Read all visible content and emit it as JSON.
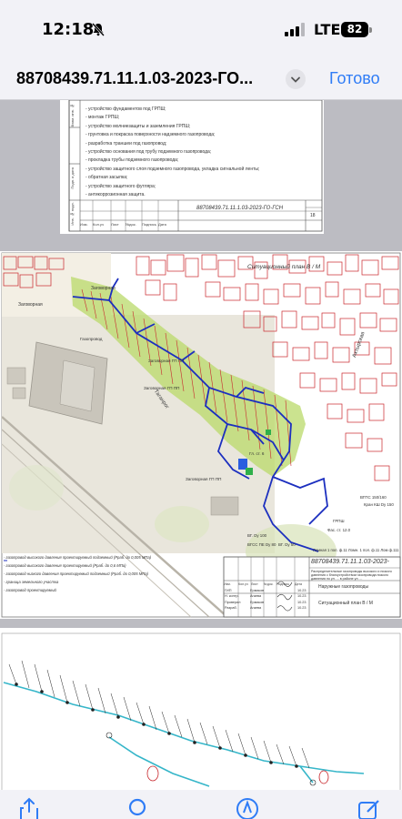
{
  "status_bar": {
    "time": "12:18",
    "network": "LTE",
    "battery": "82"
  },
  "nav": {
    "title": "88708439.71.11.1.03-2023-ГО...",
    "done_label": "Готово"
  },
  "page1": {
    "list_items": [
      "- устройство фундаментов под ГРПШ;",
      "- монтаж ГРПШ;",
      "- устройство молниезащиты и заземления ГРПШ;",
      "- грунтовка и покраска поверхности надземного газопровода;",
      "- разработка траншеи под газопровод;",
      "- устройство основания под трубу подземного газопровода;",
      "- прокладка трубы подземного газопровода;",
      "- устройство защитного слоя подземного газопровода, укладка сигнальной ленты;",
      "- обратная засыпка;",
      "- устройство защитного футляра;",
      "- антикоррозионная защита."
    ],
    "side_labels": [
      "Взам. инв. №",
      "Подп. и дата",
      "Инв. № подл."
    ],
    "stamp_headers": [
      "Изм.",
      "Кол.уч",
      "Лист",
      "№док.",
      "Подпись",
      "Дата"
    ],
    "stamp_code": "88708439.71.11.1.03-2023-ГО-ГСН",
    "stamp_sheet": "18"
  },
  "page2": {
    "map_title": "Ситуационный план В / М",
    "map_labels": [
      "Ахтырская",
      "Заговорная",
      "Заговорная",
      "Таганрог",
      "Заговорная ГП ПП",
      "Заговорная ГП ПП",
      "Заговорная ГП ПП",
      "Газопровод",
      "Гл. ст. 6",
      "ВГ. Dу 100",
      "ВГСС ПЕ Dу 80",
      "ГРПШ",
      "ВГ. Dу 50",
      "Кран КШ Dу 150",
      "ВГПС 150/160",
      "Фас. ст. 12.0"
    ],
    "stamp_code": "88708439.71.11.1.03-2023-",
    "stamp_desc": "Распределительные газопроводы высокого и низкого давления с благоустройством газопровода низкого давления по ул. ... в районе ул. ...",
    "stamp_headers": [
      "Изм.",
      "Кол.уч",
      "Лист",
      "№док.",
      "Подпись",
      "Дата"
    ],
    "stamp_people": [
      {
        "role": "ГИП",
        "name": "Ермаков",
        "date": "10.23"
      },
      {
        "role": "Н. контр.",
        "name": "Агаева",
        "date": "10.23"
      },
      {
        "role": "Проверил",
        "name": "Ермаков",
        "date": "10.23"
      },
      {
        "role": "Разраб.",
        "name": "Агаева",
        "date": "10.23"
      }
    ],
    "stamp_section": "Наружные газопроводы",
    "stamp_sheet_title": "Ситуационный план В / М",
    "legend": [
      "- газопровод высокого давления проектируемый подземный (Рраб. до 0,005 МПа)",
      "- газопровод высокого давления проектируемый (Рраб. до 0,6 МПа)",
      "- газопровод низкого давления проектируемый подземный (Рраб. до 0,005 МПа)",
      "- граница земельного участка",
      "- газопровод проектируемый"
    ],
    "footer_note": "Ломная 1 пол. ф.11 Ломн. 1 пол. ф.11 Лом ф.111"
  },
  "colors": {
    "accent": "#2f7cf6",
    "pipe_blue": "#1c2fbf",
    "parcel_red": "#c8262b",
    "highlight_green": "#b9d96a"
  }
}
